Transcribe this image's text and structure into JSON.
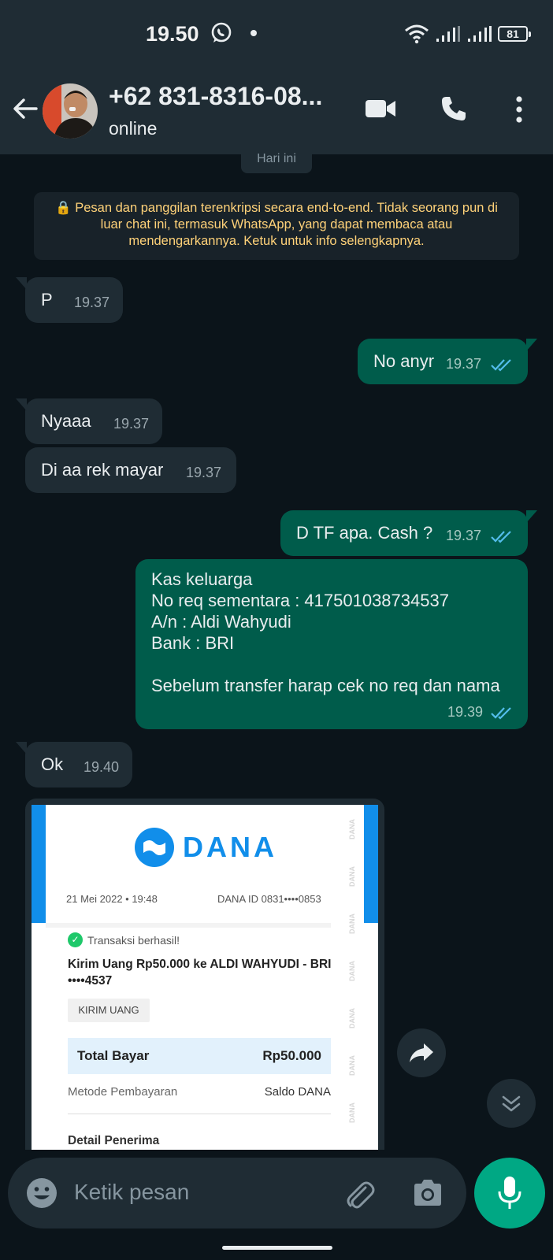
{
  "status_bar": {
    "time": "19.50",
    "battery": "81"
  },
  "header": {
    "contact_name": "+62 831-8316-08...",
    "contact_status": "online"
  },
  "chat": {
    "date_chip": "Hari ini",
    "encryption_notice": "🔒 Pesan dan panggilan terenkripsi secara end-to-end. Tidak seorang pun di luar chat ini, termasuk WhatsApp, yang dapat membaca atau mendengarkannya. Ketuk untuk info selengkapnya.",
    "messages": [
      {
        "direction": "in",
        "text": "P",
        "time": "19.37"
      },
      {
        "direction": "out",
        "text": "No anyr",
        "time": "19.37",
        "status": "read"
      },
      {
        "direction": "in",
        "text": "Nyaaa",
        "time": "19.37"
      },
      {
        "direction": "in",
        "text": "Di aa rek mayar",
        "time": "19.37"
      },
      {
        "direction": "out",
        "text": "D TF apa.  Cash ?",
        "time": "19.37",
        "status": "read"
      },
      {
        "direction": "out",
        "text": "Kas keluarga\nNo req sementara : 417501038734537\nA/n : Aldi Wahyudi\nBank : BRI\n\nSebelum transfer harap cek no req dan nama",
        "time": "19.39",
        "status": "read"
      },
      {
        "direction": "in",
        "text": "Ok",
        "time": "19.40"
      }
    ],
    "receipt": {
      "brand": "DANA",
      "date": "21 Mei 2022 • 19:48",
      "dana_id": "DANA ID 0831••••0853",
      "success": "Transaksi berhasil!",
      "description": "Kirim Uang Rp50.000 ke ALDI WAHYUDI - BRI ••••4537",
      "tag": "KIRIM UANG",
      "total_label": "Total Bayar",
      "total_value": "Rp50.000",
      "method_label": "Metode Pembayaran",
      "method_value": "Saldo DANA",
      "detail_label": "Detail Penerima",
      "watermark": "DANA"
    }
  },
  "input": {
    "placeholder": "Ketik pesan"
  },
  "colors": {
    "accent": "#00a884",
    "outgoing": "#005c4b",
    "incoming": "#1f2c34",
    "read_ticks": "#53bdeb",
    "dana_blue": "#118eea"
  }
}
